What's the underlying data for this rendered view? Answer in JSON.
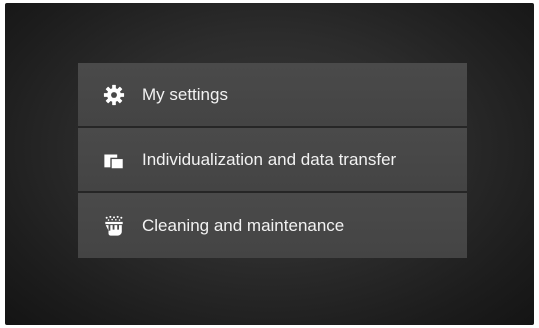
{
  "menu": {
    "items": [
      {
        "label": "My settings",
        "icon": "gear-icon"
      },
      {
        "label": "Individualization and data transfer",
        "icon": "data-transfer-icon"
      },
      {
        "label": "Cleaning and maintenance",
        "icon": "cleaning-icon"
      }
    ]
  },
  "colors": {
    "background": "#2c2c2c",
    "menu_item": "#474747",
    "separator": "#262626",
    "text": "#f2f2f2",
    "icon": "#ffffff"
  }
}
